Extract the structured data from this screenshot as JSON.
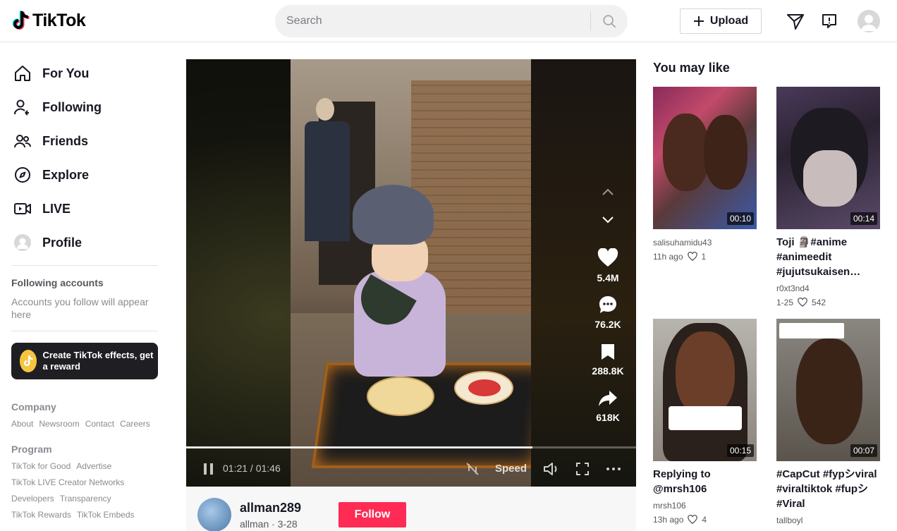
{
  "header": {
    "logo_text": "TikTok",
    "search_placeholder": "Search",
    "upload_label": "Upload"
  },
  "sidebar": {
    "nav": [
      {
        "label": "For You",
        "icon": "home-icon"
      },
      {
        "label": "Following",
        "icon": "following-icon"
      },
      {
        "label": "Friends",
        "icon": "friends-icon"
      },
      {
        "label": "Explore",
        "icon": "compass-icon"
      },
      {
        "label": "LIVE",
        "icon": "live-icon"
      },
      {
        "label": "Profile",
        "icon": "profile-avatar"
      }
    ],
    "following_title": "Following accounts",
    "following_empty": "Accounts you follow will appear here",
    "effects_cta": "Create TikTok effects, get a reward",
    "footer": {
      "company_title": "Company",
      "company_links": [
        "About",
        "Newsroom",
        "Contact",
        "Careers"
      ],
      "program_title": "Program",
      "program_row1": [
        "TikTok for Good",
        "Advertise"
      ],
      "program_row2": [
        "TikTok LIVE Creator Networks"
      ],
      "program_row3": [
        "Developers",
        "Transparency"
      ],
      "program_row4": [
        "TikTok Rewards",
        "TikTok Embeds"
      ]
    }
  },
  "video": {
    "likes": "5.4M",
    "comments": "76.2K",
    "saves": "288.8K",
    "shares": "618K",
    "time": "01:21 / 01:46",
    "progress_fraction": 0.77,
    "speed_label": "Speed",
    "author": {
      "username": "allman289",
      "meta": "allman · 3-28",
      "follow_label": "Follow"
    }
  },
  "recommendations": {
    "title": "You may like",
    "cards": [
      {
        "duration": "00:10",
        "title": "",
        "user": "salisuhamidu43",
        "ago": "11h ago",
        "likes": "1"
      },
      {
        "duration": "00:14",
        "title": "Toji 🗿#anime #animeedit #jujutsukaisen…",
        "user": "r0xt3nd4",
        "ago": "1-25",
        "likes": "542"
      },
      {
        "duration": "00:15",
        "title": "Replying to @mrsh106",
        "user": "mrsh106",
        "ago": "13h ago",
        "likes": "4"
      },
      {
        "duration": "00:07",
        "title": "#CapCut #fypシviral #viraltiktok #fupシ #Viral",
        "user": "tallboyl",
        "ago": "",
        "likes": ""
      }
    ]
  }
}
